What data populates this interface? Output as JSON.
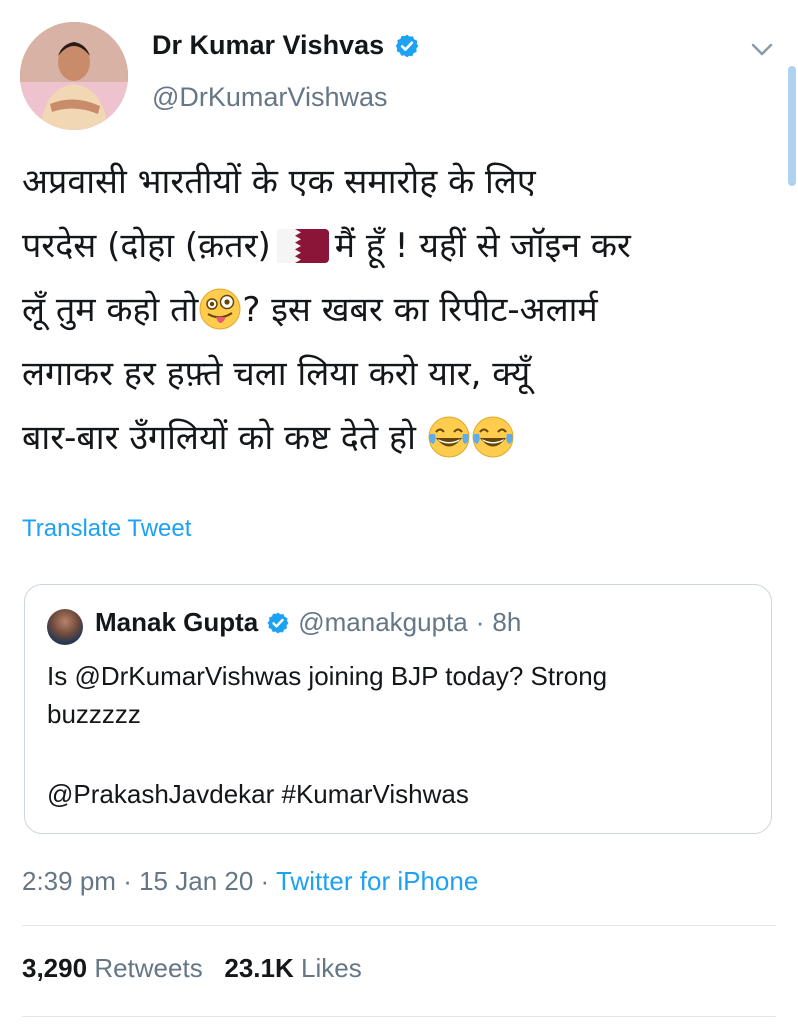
{
  "author": {
    "display_name": "Dr Kumar Vishvas",
    "handle": "@DrKumarVishwas",
    "verified_icon": "verified-badge-icon"
  },
  "tweet": {
    "line1": "अप्रवासी भारतीयों के एक समारोह के लिए",
    "line2_a": "परदेस (दोहा (क़तर)",
    "line2_b": "मैं हूँ ! यहीं से जॉइन कर",
    "line3_a": "लूँ तुम कहो तो",
    "line3_b": "? इस खबर का रिपीट-अलार्म",
    "line4": "लगाकर हर हफ़्ते चला लिया करो यार, क्यूँ",
    "line5": "बार-बार उँगलियों को कष्ट देते हो",
    "flag_icon": "qatar-flag-icon",
    "emoji_wink": "winking-tongue-emoji",
    "emoji_laugh": "tears-of-joy-emoji"
  },
  "translate_label": "Translate Tweet",
  "quoted": {
    "name": "Manak Gupta",
    "handle": "@manakgupta",
    "separator": "·",
    "time": "8h",
    "text_line1": "Is @DrKumarVishwas joining BJP today? Strong",
    "text_line2": "buzzzzz",
    "text_line3": "@PrakashJavdekar #KumarVishwas"
  },
  "meta": {
    "time": "2:39 pm",
    "sep1": "·",
    "date": "15 Jan 20",
    "sep2": "·",
    "source": "Twitter for iPhone"
  },
  "stats": {
    "retweets_count": "3,290",
    "retweets_label": "Retweets",
    "likes_count": "23.1K",
    "likes_label": "Likes"
  },
  "colors": {
    "accent": "#1da1f2",
    "secondary_text": "#657786",
    "border": "#ccd6dd",
    "qatar_maroon": "#8a1538"
  }
}
